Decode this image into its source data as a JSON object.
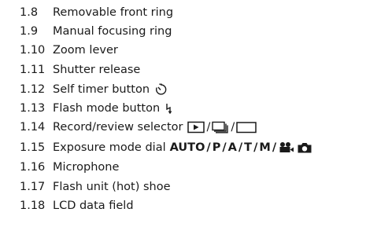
{
  "items": [
    {
      "number": "1.8",
      "label": "Removable front ring"
    },
    {
      "number": "1.9",
      "label": "Manual focusing ring"
    },
    {
      "number": "1.10",
      "label": "Zoom lever"
    },
    {
      "number": "1.11",
      "label": "Shutter release"
    },
    {
      "number": "1.12",
      "label": "Self timer button"
    },
    {
      "number": "1.13",
      "label": "Flash mode button"
    },
    {
      "number": "1.14",
      "label": "Record/review selector"
    },
    {
      "number": "1.15",
      "label": "Exposure mode dial",
      "modes": [
        "AUTO",
        "P",
        "A",
        "T",
        "M"
      ],
      "separator": "/"
    },
    {
      "number": "1.16",
      "label": "Microphone"
    },
    {
      "number": "1.17",
      "label": "Flash unit (hot) shoe"
    },
    {
      "number": "1.18",
      "label": "LCD data field"
    }
  ],
  "icons": {
    "self_timer": "self-timer-icon",
    "flash_mode": "flash-mode-icon",
    "review": "play-review-icon",
    "continuous": "continuous-shooting-icon",
    "single": "single-frame-icon",
    "movie": "movie-camera-icon",
    "camera": "still-camera-icon"
  }
}
